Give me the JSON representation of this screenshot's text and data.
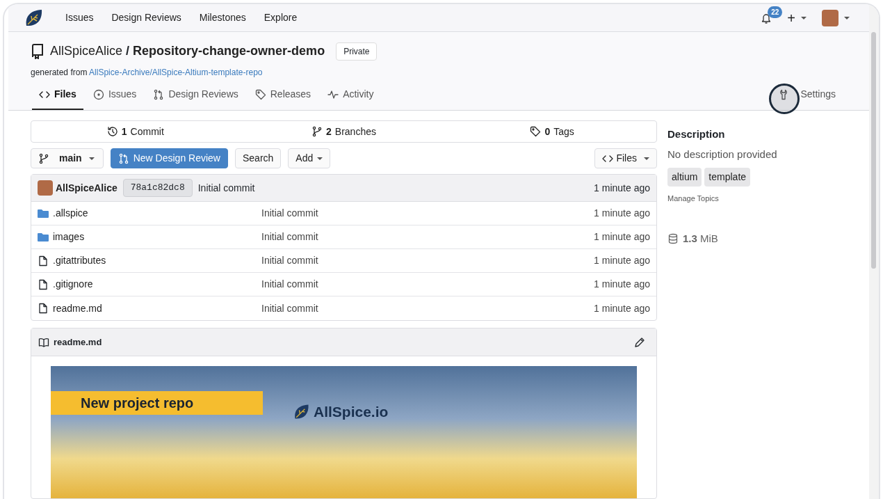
{
  "nav": {
    "items": [
      "Issues",
      "Design Reviews",
      "Milestones",
      "Explore"
    ],
    "notifications": "22",
    "create": "+"
  },
  "repo": {
    "owner": "AllSpiceAlice",
    "separator": "/",
    "name": "Repository-change-owner-demo",
    "visibility": "Private",
    "generated_label": "generated from",
    "generated_link": "AllSpice-Archive/AllSpice-Altium-template-repo"
  },
  "tabs": [
    {
      "kind": "code",
      "label": "Files",
      "selected": true
    },
    {
      "kind": "issue",
      "label": "Issues",
      "selected": false
    },
    {
      "kind": "review",
      "label": "Design Reviews",
      "selected": false
    },
    {
      "kind": "tag",
      "label": "Releases",
      "selected": false
    },
    {
      "kind": "activity",
      "label": "Activity",
      "selected": false
    },
    {
      "kind": "settings",
      "label": "Settings",
      "selected": false
    }
  ],
  "stats": [
    {
      "kind": "commit",
      "value": "1",
      "label": "Commit"
    },
    {
      "kind": "branch",
      "value": "2",
      "label": "Branches"
    },
    {
      "kind": "tag",
      "value": "0",
      "label": "Tags"
    }
  ],
  "toolbar": {
    "branch": "main",
    "new_review": "New Design Review",
    "search": "Search",
    "add": "Add",
    "files": "Files"
  },
  "latest_commit": {
    "author": "AllSpiceAlice",
    "sha": "78a1c82dc8",
    "message": "Initial commit",
    "time": "1 minute ago"
  },
  "files": [
    {
      "kind": "folder",
      "name": ".allspice",
      "message": "Initial commit",
      "time": "1 minute ago"
    },
    {
      "kind": "folder",
      "name": "images",
      "message": "Initial commit",
      "time": "1 minute ago"
    },
    {
      "kind": "file",
      "name": ".gitattributes",
      "message": "Initial commit",
      "time": "1 minute ago"
    },
    {
      "kind": "file",
      "name": ".gitignore",
      "message": "Initial commit",
      "time": "1 minute ago"
    },
    {
      "kind": "file",
      "name": "readme.md",
      "message": "Initial commit",
      "time": "1 minute ago"
    }
  ],
  "readme": {
    "title": "readme.md",
    "banner_headline": "New project repo",
    "banner_logo": "AllSpice.io"
  },
  "sidebar": {
    "heading": "Description",
    "description": "No description provided",
    "topics": [
      "altium",
      "template"
    ],
    "manage_topics": "Manage Topics",
    "size_value": "1.3",
    "size_unit": "MiB"
  }
}
